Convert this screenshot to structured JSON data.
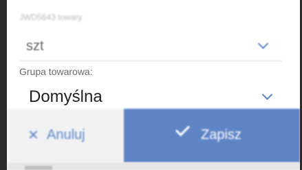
{
  "unit_field": {
    "caption": "JWD5643 towary",
    "value": "szt",
    "chevron_icon": "chevron-down-icon"
  },
  "group_field": {
    "label": "Grupa towarowa:",
    "value": "Domyślna",
    "chevron_icon": "chevron-down-icon"
  },
  "actions": {
    "cancel_icon": "✕",
    "cancel_label": "Anuluj",
    "save_label": "Zapisz"
  },
  "colors": {
    "accent": "#5f84c6",
    "link": "#5b86cc",
    "cancel_bg": "#f2f2f2",
    "frame": "#2a2a2a"
  }
}
